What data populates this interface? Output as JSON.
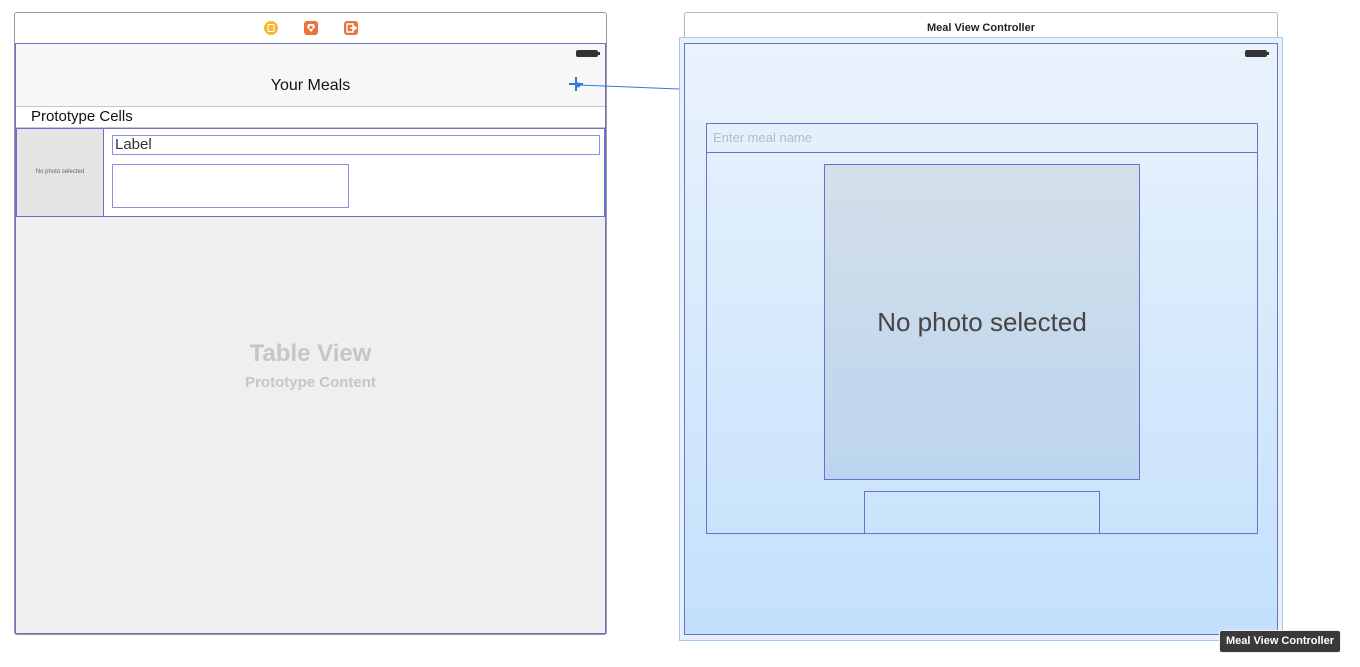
{
  "table_scene": {
    "dock_icons": [
      {
        "name": "view-controller-icon",
        "color": "#f4b92f"
      },
      {
        "name": "first-responder-icon",
        "color": "#e8733c"
      },
      {
        "name": "exit-icon",
        "color": "#e8733c"
      }
    ],
    "nav_title": "Your Meals",
    "add_button_icon": "plus-icon",
    "section_header": "Prototype Cells",
    "cell": {
      "photo_text": "No photo selected",
      "label": "Label"
    },
    "placeholder": {
      "title": "Table View",
      "subtitle": "Prototype Content"
    }
  },
  "meal_scene": {
    "title": "Meal View Controller",
    "name_field_placeholder": "Enter meal name",
    "photo_text": "No photo selected",
    "badge": "Meal View Controller"
  },
  "colors": {
    "selection_blue": "#6b6fd0",
    "segue_blue": "#2d7de0",
    "dock_yellow": "#f4b92f",
    "dock_orange": "#e8733c"
  }
}
